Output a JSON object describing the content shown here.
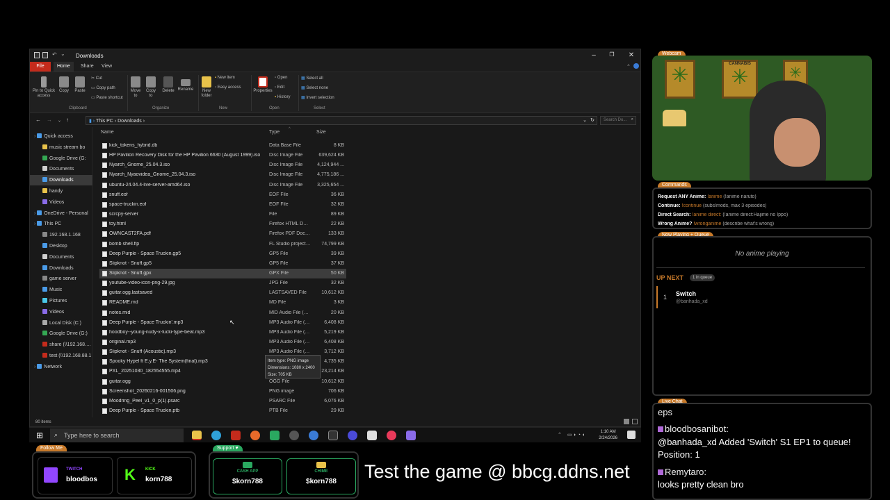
{
  "explorer": {
    "title": "Downloads",
    "ribbon_tabs": [
      "File",
      "Home",
      "Share",
      "View"
    ],
    "clipboard": {
      "pin": "Pin to Quick access",
      "copy": "Copy",
      "paste": "Paste",
      "cut": "Cut",
      "copy_path": "Copy path",
      "paste_shortcut": "Paste shortcut",
      "label": "Clipboard"
    },
    "organize": {
      "move": "Move to",
      "copy": "Copy to",
      "delete": "Delete",
      "rename": "Rename",
      "label": "Organize"
    },
    "new": {
      "new_folder": "New folder",
      "new_item": "New item",
      "easy_access": "Easy access",
      "label": "New"
    },
    "open": {
      "properties": "Properties",
      "open": "Open",
      "edit": "Edit",
      "history": "History",
      "label": "Open"
    },
    "select": {
      "all": "Select all",
      "none": "Select none",
      "invert": "Invert selection",
      "label": "Select"
    },
    "breadcrumb": [
      "This PC",
      "Downloads"
    ],
    "search_placeholder": "Search Do...",
    "columns": {
      "name": "Name",
      "type": "Type",
      "size": "Size"
    },
    "nav": [
      {
        "label": "Quick access",
        "color": "#4a9be8",
        "indent": 0,
        "selected": false
      },
      {
        "label": "music stream bo",
        "color": "#e8c24a",
        "indent": 1,
        "selected": false
      },
      {
        "label": "Google Drive (G:",
        "color": "#34a853",
        "indent": 1,
        "selected": false
      },
      {
        "label": "Documents",
        "color": "#cfcfcf",
        "indent": 1,
        "selected": false
      },
      {
        "label": "Downloads",
        "color": "#4a9be8",
        "indent": 1,
        "selected": true
      },
      {
        "label": "handy",
        "color": "#e8c24a",
        "indent": 1,
        "selected": false
      },
      {
        "label": "Videos",
        "color": "#8a6be8",
        "indent": 1,
        "selected": false
      },
      {
        "label": "OneDrive - Personal",
        "color": "#4a9be8",
        "indent": 0,
        "selected": false
      },
      {
        "label": "This PC",
        "color": "#4a9be8",
        "indent": 0,
        "selected": false
      },
      {
        "label": "192.168.1.168",
        "color": "#888888",
        "indent": 1,
        "selected": false
      },
      {
        "label": "Desktop",
        "color": "#4a9be8",
        "indent": 1,
        "selected": false
      },
      {
        "label": "Documents",
        "color": "#cfcfcf",
        "indent": 1,
        "selected": false
      },
      {
        "label": "Downloads",
        "color": "#4a9be8",
        "indent": 1,
        "selected": false
      },
      {
        "label": "game server",
        "color": "#888888",
        "indent": 1,
        "selected": false
      },
      {
        "label": "Music",
        "color": "#4a9be8",
        "indent": 1,
        "selected": false
      },
      {
        "label": "Pictures",
        "color": "#4ac8e8",
        "indent": 1,
        "selected": false
      },
      {
        "label": "Videos",
        "color": "#8a6be8",
        "indent": 1,
        "selected": false
      },
      {
        "label": "Local Disk (C:)",
        "color": "#aaaaaa",
        "indent": 1,
        "selected": false
      },
      {
        "label": "Google Drive (G:)",
        "color": "#34a853",
        "indent": 1,
        "selected": false
      },
      {
        "label": "share (\\\\192.168.1.2",
        "color": "#c42b1c",
        "indent": 1,
        "selected": false
      },
      {
        "label": "test (\\\\192.168.88.1",
        "color": "#c42b1c",
        "indent": 1,
        "selected": false
      },
      {
        "label": "Network",
        "color": "#4a9be8",
        "indent": 0,
        "selected": false
      }
    ],
    "files": [
      {
        "name": "kick_tokens_hybrid.db",
        "type": "Data Base File",
        "size": "8 KB"
      },
      {
        "name": "HP Pavilion Recovery Disk for the HP Pavilion 6630 (August 1999).iso",
        "type": "Disc Image File",
        "size": "639,624 KB"
      },
      {
        "name": "Nyarch_Gnome_25.04.3.iso",
        "type": "Disc Image File",
        "size": "4,124,944 ..."
      },
      {
        "name": "Nyarch_Nyaovidea_Gnome_25.04.3.iso",
        "type": "Disc Image File",
        "size": "4,775,186 ..."
      },
      {
        "name": "ubuntu-24.04.4-live-server-amd64.iso",
        "type": "Disc Image File",
        "size": "3,325,654 ..."
      },
      {
        "name": "snuff.eof",
        "type": "EOF File",
        "size": "36 KB"
      },
      {
        "name": "space-truckin.eof",
        "type": "EOF File",
        "size": "32 KB"
      },
      {
        "name": "scrcpy-server",
        "type": "File",
        "size": "89 KB"
      },
      {
        "name": "toy.html",
        "type": "Firefox HTML Doc...",
        "size": "22 KB"
      },
      {
        "name": "OWNCAST2FA.pdf",
        "type": "Firefox PDF Docu...",
        "size": "133 KB"
      },
      {
        "name": "bomb shell.flp",
        "type": "FL Studio project f...",
        "size": "74,799 KB"
      },
      {
        "name": "Deep Purple - Space Truckin.gp5",
        "type": "GP5 File",
        "size": "39 KB"
      },
      {
        "name": "Slipknot - Snuff.gp5",
        "type": "GP5 File",
        "size": "37 KB"
      },
      {
        "name": "Slipknot - Snuff.gpx",
        "type": "GPX File",
        "size": "50 KB",
        "selected": true
      },
      {
        "name": "youtube-video-icon-png-29.jpg",
        "type": "JPG File",
        "size": "32 KB"
      },
      {
        "name": "guitar.ogg.lastsaved",
        "type": "LASTSAVED File",
        "size": "10,612 KB"
      },
      {
        "name": "README.md",
        "type": "MD File",
        "size": "3 KB"
      },
      {
        "name": "notes.mid",
        "type": "MID Audio File (VL...",
        "size": "20 KB"
      },
      {
        "name": "Deep Purple - Space Truckin'.mp3",
        "type": "MP3 Audio File (V...",
        "size": "6,408 KB"
      },
      {
        "name": "hoodboy--young-nudy-x-lucki-type-beat.mp3",
        "type": "MP3 Audio File (V...",
        "size": "5,219 KB"
      },
      {
        "name": "original.mp3",
        "type": "MP3 Audio File (V...",
        "size": "6,408 KB"
      },
      {
        "name": "Slipknot - Snuff (Acoustic).mp3",
        "type": "MP3 Audio File (V...",
        "size": "3,712 KB"
      },
      {
        "name": "Spooky Hypel ft E.y.E- The System(final).mp3",
        "type": "MP3 Audio File (V...",
        "size": "4,735 KB"
      },
      {
        "name": "PXL_20251030_182554555.mp4",
        "type": "MP4 Video File (VL...",
        "size": "23,214 KB"
      },
      {
        "name": "guitar.ogg",
        "type": "OGG File",
        "size": "10,612 KB"
      },
      {
        "name": "Screenshot_20260216-001506.png",
        "type": "PNG image",
        "size": "706 KB"
      },
      {
        "name": "Moodring_Peel_v1_0_p(1).psarc",
        "type": "PSARC File",
        "size": "6,076 KB"
      },
      {
        "name": "Deep Purple - Space Truckin.ptb",
        "type": "PTB File",
        "size": "29 KB"
      }
    ],
    "tooltip": {
      "line1": "Item type: PNG image",
      "line2": "Dimensions: 1080 x 2400",
      "line3": "Size: 705 KB"
    },
    "status": "80 items"
  },
  "taskbar": {
    "search_placeholder": "Type here to search",
    "time": "1:10 AM",
    "date": "2/24/2026"
  },
  "stream": {
    "webcam_label": "Webcam",
    "poster_text": "CANNABIS",
    "commands_label": "Commands",
    "commands": [
      {
        "key": "Request ANY Anime:",
        "cmd": "!anime",
        "desc": "(!anime naruto)"
      },
      {
        "key": "Continue:",
        "cmd": "!continue",
        "desc": "(subs/mods, max 3 episodes)"
      },
      {
        "key": "Direct Search:",
        "cmd": "!anime direct:",
        "desc": "(!anime direct:Hajime no Ippo)"
      },
      {
        "key": "Wrong Anime?",
        "cmd": "!wronganime",
        "desc": "(describe what's wrong)"
      }
    ],
    "queue_label": "Now Playing + Queue",
    "now_playing": "No anime playing",
    "up_next": "UP NEXT",
    "queue_count": "1 in queue",
    "queue_item": {
      "num": "1",
      "title": "Switch",
      "by": "@banhada_xd"
    },
    "chat_label": "Live Chat",
    "chat": [
      {
        "user": "",
        "msg": "eps"
      },
      {
        "user": "bloodbosanibot:",
        "msg": "@banhada_xd Added 'Switch' S1 EP1 to queue! Position: 1"
      },
      {
        "user": "Remytaro:",
        "msg": "looks pretty clean bro"
      }
    ],
    "follow_label": "Follow Me",
    "twitch": {
      "platform": "TWITCH",
      "name": "bloodbos"
    },
    "kick": {
      "platform": "KICK",
      "name": "korn788"
    },
    "support_label": "Support",
    "cashapp": {
      "label": "CASH APP",
      "handle": "$korn788"
    },
    "chime": {
      "label": "CHIME",
      "handle": "$korn788"
    },
    "banner": "Test the game @ bbcg.ddns.net"
  }
}
